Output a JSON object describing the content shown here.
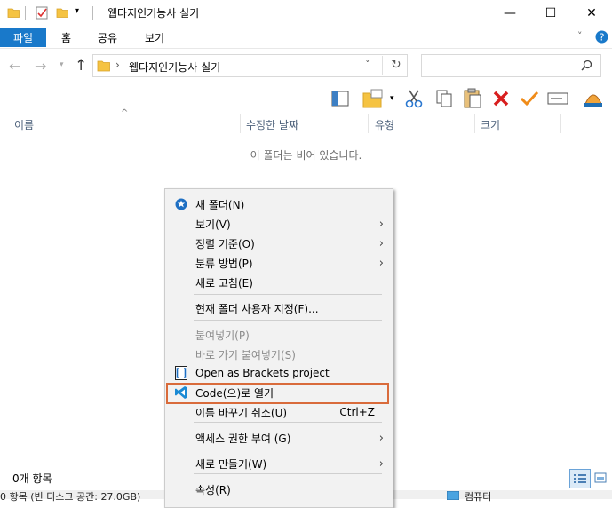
{
  "window": {
    "title": "웹다지인기능사 실기",
    "minimize": "—",
    "maximize": "☐",
    "close": "✕"
  },
  "ribbon": {
    "tabs": [
      "파일",
      "홈",
      "공유",
      "보기"
    ]
  },
  "address": {
    "path": "웹다지인기능사 실기",
    "separator": "›"
  },
  "columns": [
    "이름",
    "수정한 날짜",
    "유형",
    "크기"
  ],
  "empty_message": "이 폴더는 비어 있습니다.",
  "status": {
    "items": "0개 항목",
    "bottom_left": "0 항목 (빈 디스크 공간: 27.0GB)",
    "bottom_right": "컴퓨터"
  },
  "context_menu": {
    "items": [
      {
        "label": "새 폴더(N)",
        "icon": "new-folder-icon"
      },
      {
        "label": "보기(V)",
        "submenu": true
      },
      {
        "label": "정렬 기준(O)",
        "submenu": true
      },
      {
        "label": "분류 방법(P)",
        "submenu": true
      },
      {
        "label": "새로 고침(E)"
      },
      {
        "label": "현재 폴더 사용자 지정(F)..."
      },
      {
        "label": "붙여넣기(P)",
        "disabled": true
      },
      {
        "label": "바로 가기 붙여넣기(S)",
        "disabled": true
      },
      {
        "label": "Open as Brackets project",
        "icon": "brackets-icon"
      },
      {
        "label": "Code(으)로 열기",
        "icon": "vscode-icon",
        "highlighted": true
      },
      {
        "label": "이름 바꾸기 취소(U)",
        "shortcut": "Ctrl+Z"
      },
      {
        "label": "액세스 권한 부여 (G)",
        "submenu": true
      },
      {
        "label": "새로 만들기(W)",
        "submenu": true
      },
      {
        "label": "속성(R)"
      }
    ],
    "submenu_arrow": "›"
  },
  "colors": {
    "accent": "#1979ca",
    "highlight_border": "#d96b3b",
    "folder": "#f5c342"
  }
}
